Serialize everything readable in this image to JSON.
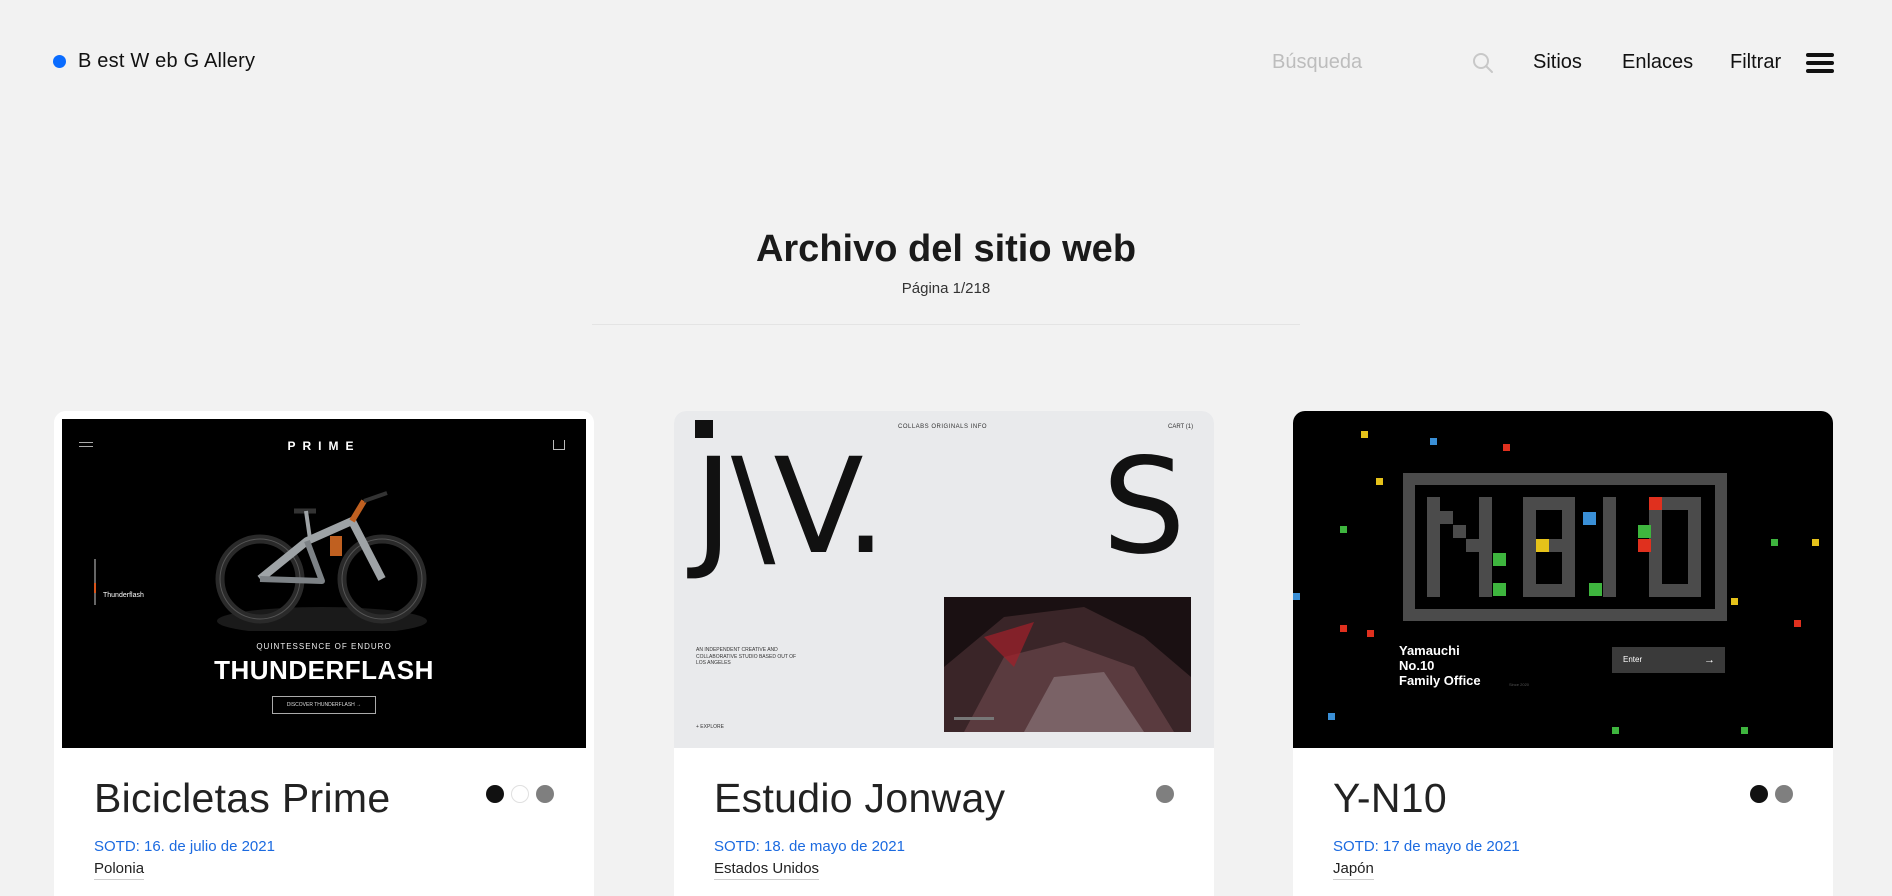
{
  "header": {
    "brand": "B est W eb G Allery",
    "brand_dot_color": "#0a6cff",
    "search_placeholder": "Búsqueda",
    "search_icon": "search-icon",
    "nav": [
      "Sitios",
      "Enlaces",
      "Filtrar"
    ],
    "menu_icon": "menu-icon"
  },
  "page": {
    "title": "Archivo del sitio web",
    "counter": "Página 1/218"
  },
  "cards": [
    {
      "name": "Bicicletas Prime",
      "date": "SOTD: 16. de julio de 2021",
      "country": "Polonia",
      "swatches": [
        "#111111",
        "#ffffff",
        "#7f7f7f"
      ],
      "thumb": {
        "logo": "PRIME",
        "side_label": "Thunderflash",
        "subtitle": "QUINTESSENCE OF ENDURO",
        "headline": "THUNDERFLASH",
        "cta": "DISCOVER THUNDERFLASH →"
      }
    },
    {
      "name": "Estudio Jonway",
      "date": "SOTD: 18. de mayo de 2021",
      "country": "Estados Unidos",
      "swatches": [
        "#7f7f7f"
      ],
      "thumb": {
        "nav": "COLLABS    ORIGINALS    INFO",
        "cart": "CART (1)",
        "wordmark": "J\\V.",
        "wordmark_s": "S",
        "blurb": "AN INDEPENDENT CREATIVE AND COLLABORATIVE STUDIO BASED OUT OF LOS ANGELES",
        "explore": "+ EXPLORE"
      }
    },
    {
      "name": "Y-N10",
      "date": "SOTD: 17 de mayo de 2021",
      "country": "Japón",
      "swatches": [
        "#111111",
        "#7f7f7f"
      ],
      "thumb": {
        "company_line1": "Yamauchi",
        "company_line2": "No.10",
        "company_line3": "Family Office",
        "enter": "Enter",
        "since": "Since 2020"
      }
    }
  ]
}
